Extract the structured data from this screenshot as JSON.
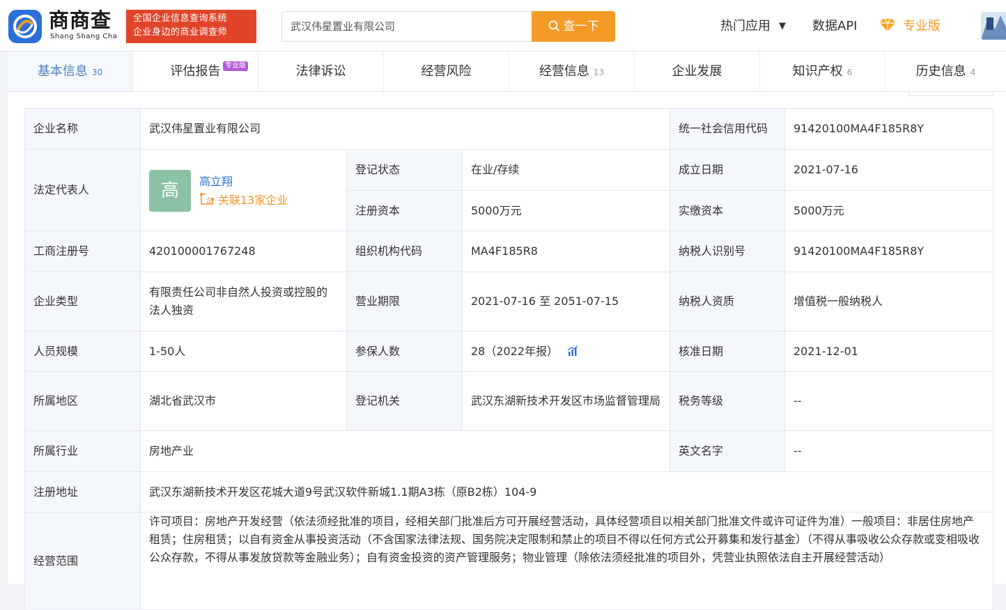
{
  "header": {
    "logo_cn": "商商查",
    "logo_en": "Shang Shang Cha",
    "slogan_line1": "全国企业信息查询系统",
    "slogan_line2": "企业身边的商业调查师",
    "search_value": "武汉伟星置业有限公司",
    "search_button": "查一下",
    "nav_hot": "热门应用",
    "nav_api": "数据API",
    "nav_pro": "专业版"
  },
  "tabs": [
    {
      "label": "基本信息",
      "count": "30"
    },
    {
      "label": "评估报告",
      "badge": "专业版"
    },
    {
      "label": "法律诉讼"
    },
    {
      "label": "经营风险"
    },
    {
      "label": "经营信息",
      "count": "13"
    },
    {
      "label": "企业发展"
    },
    {
      "label": "知识产权",
      "count": "6"
    },
    {
      "label": "历史信息",
      "count": "4"
    }
  ],
  "info": {
    "company_name_label": "企业名称",
    "company_name": "武汉伟星置业有限公司",
    "credit_code_label": "统一社会信用代码",
    "credit_code": "91420100MA4F185R8Y",
    "legal_rep_label": "法定代表人",
    "legal_rep_avatar": "高",
    "legal_rep_name": "高立翔",
    "legal_rep_related": "关联13家企业",
    "reg_status_label": "登记状态",
    "reg_status": "在业/存续",
    "found_date_label": "成立日期",
    "found_date": "2021-07-16",
    "reg_capital_label": "注册资本",
    "reg_capital": "5000万元",
    "paid_capital_label": "实缴资本",
    "paid_capital": "5000万元",
    "biz_reg_no_label": "工商注册号",
    "biz_reg_no": "420100001767248",
    "org_code_label": "组织机构代码",
    "org_code": "MA4F185R8",
    "taxpayer_id_label": "纳税人识别号",
    "taxpayer_id": "91420100MA4F185R8Y",
    "company_type_label": "企业类型",
    "company_type": "有限责任公司非自然人投资或控股的法人独资",
    "biz_term_label": "营业期限",
    "biz_term": "2021-07-16 至 2051-07-15",
    "taxpayer_qual_label": "纳税人资质",
    "taxpayer_qual": "增值税一般纳税人",
    "staff_size_label": "人员规模",
    "staff_size": "1-50人",
    "insured_label": "参保人数",
    "insured": "28（2022年报）",
    "approve_date_label": "核准日期",
    "approve_date": "2021-12-01",
    "region_label": "所属地区",
    "region": "湖北省武汉市",
    "authority_label": "登记机关",
    "authority": "武汉东湖新技术开发区市场监督管理局",
    "tax_grade_label": "税务等级",
    "tax_grade": "--",
    "industry_label": "所属行业",
    "industry": "房地产业",
    "english_name_label": "英文名字",
    "english_name": "--",
    "address_label": "注册地址",
    "address": "武汉东湖新技术开发区花城大道9号武汉软件新城1.1期A3栋（原B2栋）104-9",
    "scope_label": "经营范围",
    "scope": "许可项目：房地产开发经营（依法须经批准的项目，经相关部门批准后方可开展经营活动，具体经营项目以相关部门批准文件或许可证件为准）一般项目：非居住房地产租赁；住房租赁；以自有资金从事投资活动（不含国家法律法规、国务院决定限制和禁止的项目不得以任何方式公开募集和发行基金）（不得从事吸收公众存款或变相吸收公众存款，不得从事发放贷款等金融业务）；自有资金投资的资产管理服务；物业管理（除依法须经批准的项目外，凭营业执照依法自主开展经营活动）"
  },
  "colors": {
    "accent_blue": "#4c7fc0",
    "search_orange": "#f39b26",
    "slogan_red": "#e0452a",
    "label_bg": "#f4f8fd"
  }
}
